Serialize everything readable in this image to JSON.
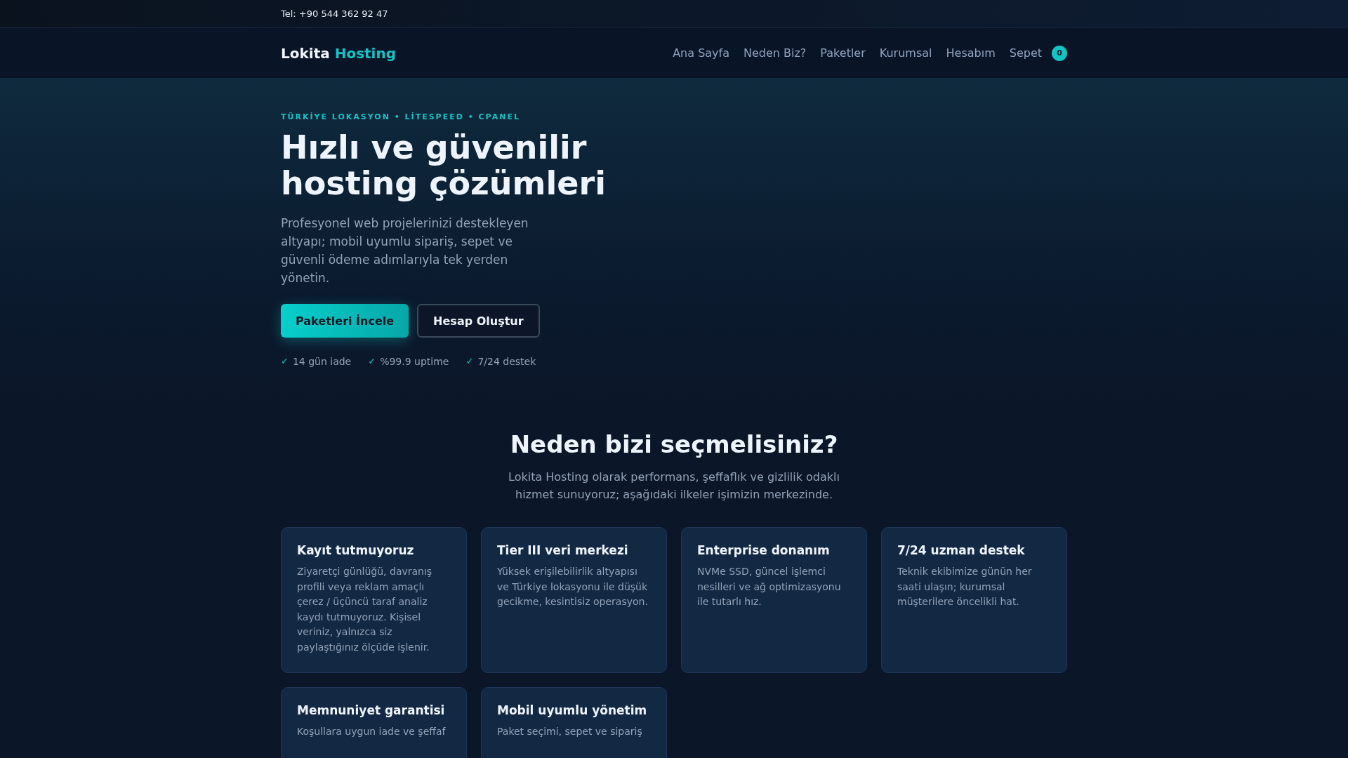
{
  "topbar": {
    "phone": "Tel: +90 544 362 92 47"
  },
  "nav": {
    "logo": {
      "first": "Lokita",
      "second": "Hosting"
    },
    "links": [
      {
        "label": "Ana Sayfa"
      },
      {
        "label": "Neden Biz?"
      },
      {
        "label": "Paketler"
      },
      {
        "label": "Kurumsal"
      },
      {
        "label": "Hesabım"
      }
    ],
    "cart": {
      "label": "Sepet",
      "count": "0"
    }
  },
  "hero": {
    "eyebrow": "TÜRKİYE LOKASYON • LİTESPEED • CPANEL",
    "title": "Hızlı ve güvenilir hosting çözümleri",
    "text": "Profesyonel web projelerinizi destekleyen altyapı; mobil uyumlu sipariş, sepet ve güvenli ödeme adımlarıyla tek yerden yönetin.",
    "buttons": [
      {
        "label": "Paketleri İncele",
        "kind": "primary"
      },
      {
        "label": "Hesap Oluştur",
        "kind": "outline"
      }
    ],
    "checks": [
      {
        "mark": "✓",
        "label": "14 gün iade"
      },
      {
        "mark": "✓",
        "label": "%99.9 uptime"
      },
      {
        "mark": "✓",
        "label": "7/24 destek"
      }
    ]
  },
  "features": {
    "title": "Neden bizi seçmelisiniz?",
    "subtitle": "Lokita Hosting olarak performans, şeffaflık ve gizlilik odaklı hizmet sunuyoruz; aşağıdaki ilkeler işimizin merkezinde.",
    "cards": [
      {
        "title": "Kayıt tutmuyoruz",
        "text": "Ziyaretçi günlüğü, davranış profili veya reklam amaçlı çerez / üçüncü taraf analiz kaydı tutmuyoruz. Kişisel veriniz, yalnızca siz paylaştığınız ölçüde işlenir."
      },
      {
        "title": "Tier III veri merkezi",
        "text": "Yüksek erişilebilirlik altyapısı ve Türkiye lokasyonu ile düşük gecikme, kesintisiz operasyon."
      },
      {
        "title": "Enterprise donanım",
        "text": "NVMe SSD, güncel işlemci nesilleri ve ağ optimizasyonu ile tutarlı hız."
      },
      {
        "title": "7/24 uzman destek",
        "text": "Teknik ekibimize günün her saati ulaşın; kurumsal müşterilere öncelikli hat."
      },
      {
        "title": "Memnuniyet garantisi",
        "text": "Koşullara uygun iade ve şeffaf"
      },
      {
        "title": "Mobil uyumlu yönetim",
        "text": "Paket seçimi, sepet ve sipariş"
      }
    ]
  }
}
